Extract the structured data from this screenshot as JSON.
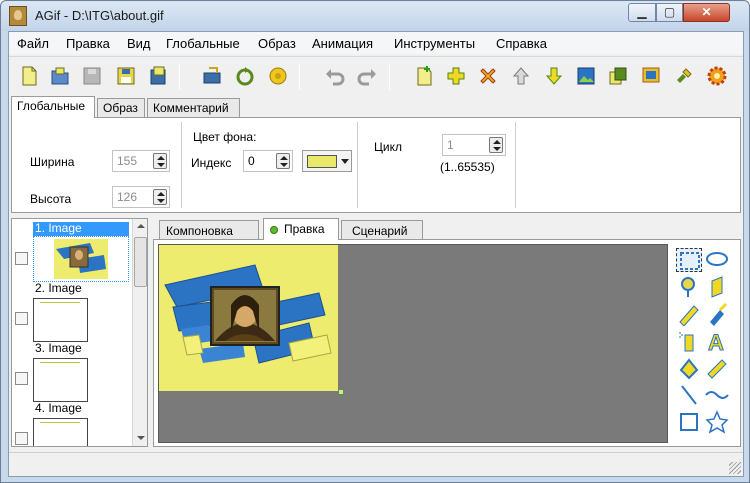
{
  "window": {
    "title": "AGif - D:\\ITG\\about.gif",
    "controls": {
      "minimize": "▁",
      "maximize": "▢",
      "close": "✕"
    }
  },
  "menu": {
    "items": [
      "Файл",
      "Правка",
      "Вид",
      "Глобальные",
      "Образ",
      "Анимация",
      "Инструменты",
      "Справка"
    ]
  },
  "toolbar": {
    "buttons": [
      "new-file-icon",
      "open-file-icon",
      "save-disabled-icon",
      "save-icon",
      "save-as-icon",
      "import-icon",
      "reload-icon",
      "play-icon",
      "undo-icon",
      "redo-icon",
      "add-frame-icon",
      "insert-icon",
      "delete-icon",
      "move-up-icon",
      "move-down-icon",
      "image-icon",
      "copy-icon",
      "export-icon",
      "tools-icon",
      "settings-icon"
    ]
  },
  "properties": {
    "tabs": [
      "Глобальные",
      "Образ",
      "Комментарий"
    ],
    "active_tab": "Глобальные",
    "width_label": "Ширина",
    "width_value": "155",
    "height_label": "Высота",
    "height_value": "126",
    "bg_color_label": "Цвет фона:",
    "index_label": "Индекс",
    "index_value": "0",
    "bg_color": "#e8e86b",
    "loop_label": "Цикл",
    "loop_value": "1",
    "loop_range": "(1..65535)"
  },
  "frames": [
    {
      "label": "1. Image",
      "selected": true
    },
    {
      "label": "2. Image",
      "selected": false
    },
    {
      "label": "3. Image",
      "selected": false
    },
    {
      "label": "4. Image",
      "selected": false
    }
  ],
  "editor": {
    "tabs": [
      "Компоновка",
      "Правка",
      "Сценарий"
    ],
    "active_tab": "Правка"
  },
  "palette": {
    "tools": [
      "select-rect-icon",
      "lasso-icon",
      "color-picker-icon",
      "eraser-icon",
      "pencil-icon",
      "brush-icon",
      "spray-icon",
      "text-icon",
      "fill-icon",
      "bucket-icon",
      "line-icon",
      "curve-icon",
      "rectangle-icon",
      "star-icon"
    ]
  },
  "colors": {
    "canvas_bg": "#7a7a7a",
    "image_yellow": "#eeec6e",
    "image_blue": "#2b74c4",
    "selection": "#3399ff"
  }
}
